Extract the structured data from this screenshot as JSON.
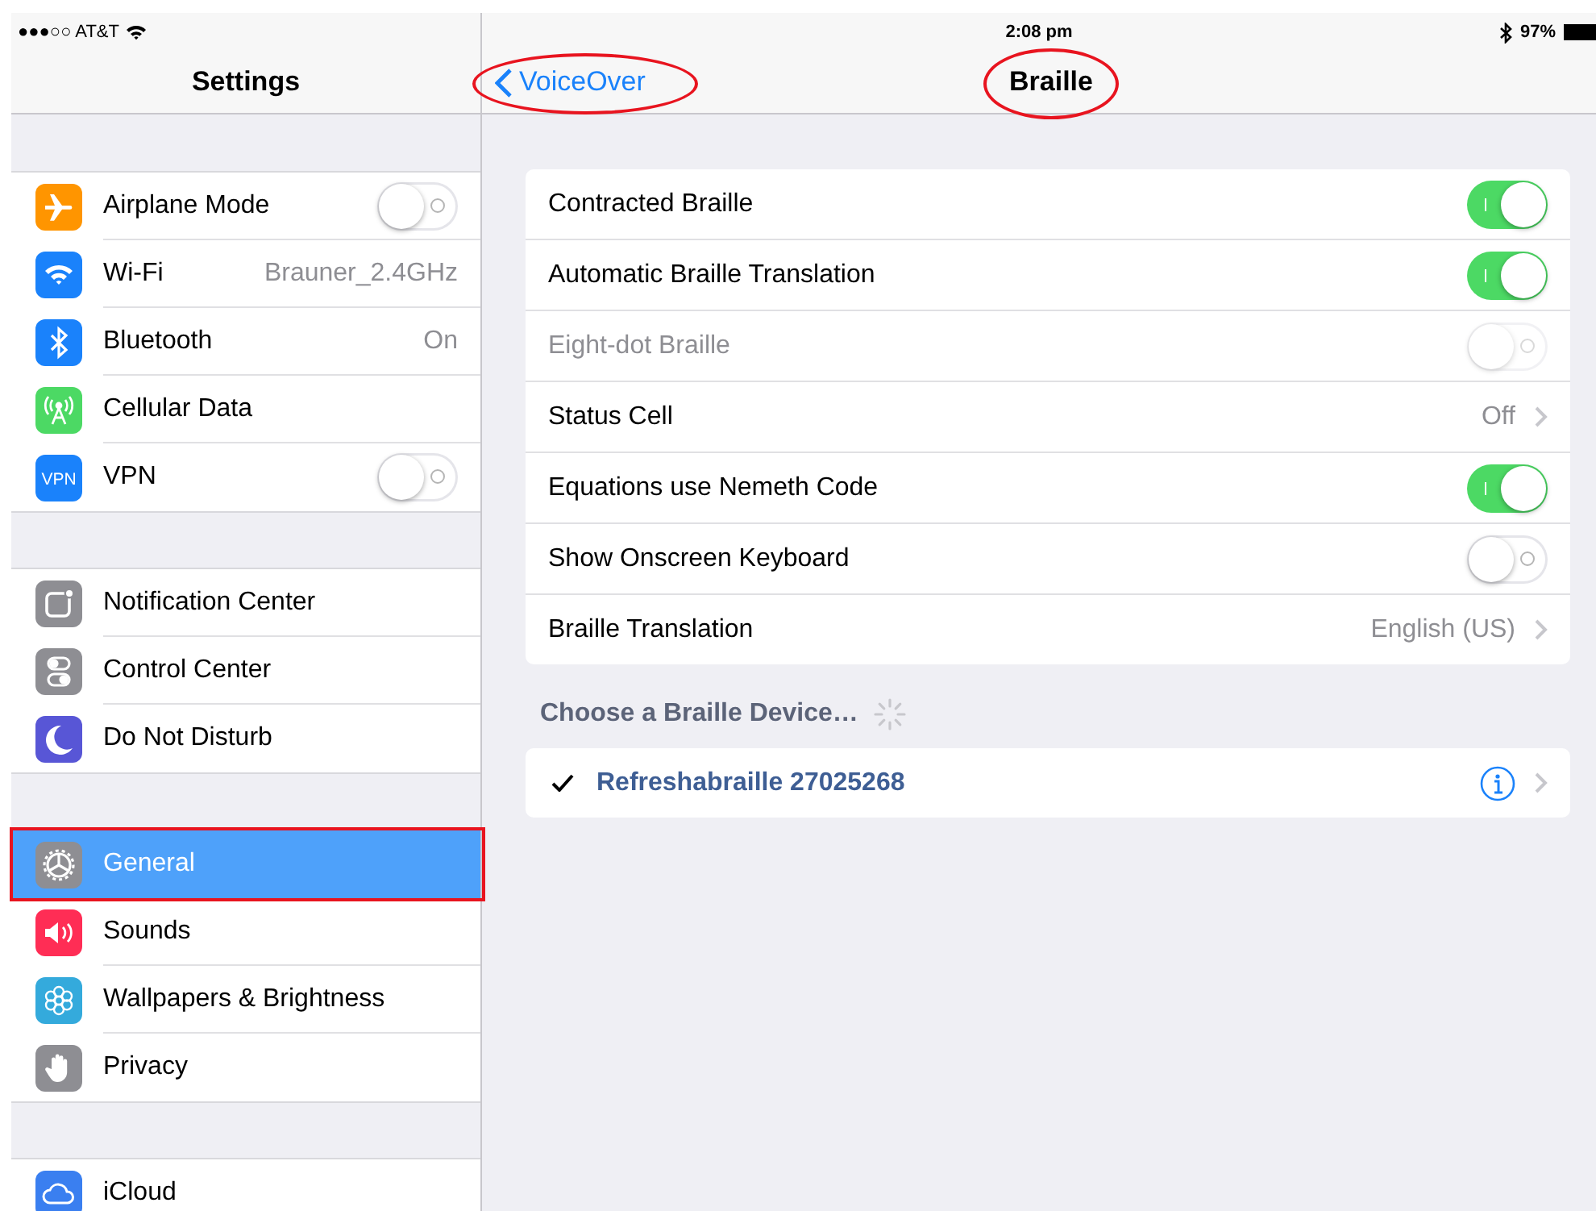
{
  "status_bar": {
    "carrier": "●●●○○ AT&T",
    "time": "2:08 pm",
    "battery": "97%"
  },
  "sidebar": {
    "title": "Settings",
    "groups": [
      {
        "items": [
          {
            "label": "Airplane Mode",
            "kind": "toggle",
            "on": false,
            "selected": false,
            "highlighted": false
          },
          {
            "label": "Wi-Fi",
            "kind": "value",
            "value": "Brauner_2.4GHz",
            "selected": false,
            "highlighted": false
          },
          {
            "label": "Bluetooth",
            "kind": "value",
            "value": "On",
            "selected": false,
            "highlighted": false
          },
          {
            "label": "Cellular Data",
            "kind": "plain",
            "selected": false,
            "highlighted": false
          },
          {
            "label": "VPN",
            "kind": "toggle",
            "on": false,
            "icon_text": "VPN",
            "selected": false,
            "highlighted": false
          }
        ]
      },
      {
        "items": [
          {
            "label": "Notification Center",
            "kind": "plain",
            "selected": false,
            "highlighted": false
          },
          {
            "label": "Control Center",
            "kind": "plain",
            "selected": false,
            "highlighted": false
          },
          {
            "label": "Do Not Disturb",
            "kind": "plain",
            "selected": false,
            "highlighted": false
          }
        ]
      },
      {
        "items": [
          {
            "label": "General",
            "kind": "plain",
            "selected": true,
            "highlighted": true
          },
          {
            "label": "Sounds",
            "kind": "plain",
            "selected": false,
            "highlighted": false
          },
          {
            "label": "Wallpapers & Brightness",
            "kind": "plain",
            "selected": false,
            "highlighted": false
          },
          {
            "label": "Privacy",
            "kind": "plain",
            "selected": false,
            "highlighted": false
          }
        ]
      },
      {
        "items": [
          {
            "label": "iCloud",
            "kind": "plain",
            "selected": false,
            "highlighted": false
          }
        ]
      }
    ]
  },
  "nav": {
    "back": {
      "label": "VoiceOver",
      "highlighted": true
    },
    "title": {
      "label": "Braille",
      "highlighted": true
    }
  },
  "settings": [
    {
      "label": "Contracted Braille",
      "kind": "toggle",
      "on": true,
      "disabled": false
    },
    {
      "label": "Automatic Braille Translation",
      "kind": "toggle",
      "on": true,
      "disabled": false
    },
    {
      "label": "Eight-dot Braille",
      "kind": "toggle",
      "on": false,
      "disabled": true
    },
    {
      "label": "Status Cell",
      "kind": "value",
      "value": "Off",
      "disabled": false
    },
    {
      "label": "Equations use Nemeth Code",
      "kind": "toggle",
      "on": true,
      "disabled": false
    },
    {
      "label": "Show Onscreen Keyboard",
      "kind": "toggle",
      "on": false,
      "disabled": false
    },
    {
      "label": "Braille Translation",
      "kind": "value",
      "value": "English (US)",
      "disabled": false
    }
  ],
  "devices": {
    "header": "Choose a Braille Device…",
    "items": [
      {
        "label": "Refreshabraille 27025268",
        "checked": true
      }
    ]
  }
}
